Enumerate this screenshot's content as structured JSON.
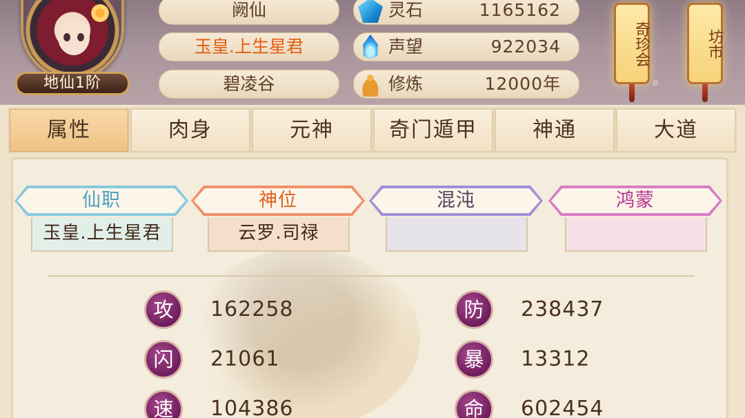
{
  "player": {
    "rank_badge": "地仙1阶",
    "name": "阙仙",
    "title": "玉皇.上生星君",
    "sect": "碧凌谷"
  },
  "resources": [
    {
      "icon": "spirit-stone-icon",
      "label": "灵石",
      "value": "1165162"
    },
    {
      "icon": "reputation-flame-icon",
      "label": "声望",
      "value": "922034"
    },
    {
      "icon": "cultivation-buddha-icon",
      "label": "修炼",
      "value": "12000年"
    }
  ],
  "lanterns": [
    {
      "label": "奇珍会"
    },
    {
      "label": "坊市"
    }
  ],
  "tabs": [
    "属性",
    "肉身",
    "元神",
    "奇门遁甲",
    "神通",
    "大道"
  ],
  "active_tab": "属性",
  "ranks": [
    {
      "header": "仙职",
      "value": "玉皇.上生星君",
      "color": "#4e9fc0",
      "border": "#88c9de",
      "value_bg": "#e2eee8"
    },
    {
      "header": "神位",
      "value": "云罗.司禄",
      "color": "#e0621c",
      "border": "#f0906a",
      "value_bg": "#f6dfca"
    },
    {
      "header": "混沌",
      "value": "",
      "color": "#5a3e5e",
      "border": "#9f8fd8",
      "value_bg": "#e7e3ea"
    },
    {
      "header": "鸿蒙",
      "value": "",
      "color": "#b8338f",
      "border": "#d97cc4",
      "value_bg": "#f6dfe6"
    }
  ],
  "stats": [
    {
      "badge": "攻",
      "value": "162258"
    },
    {
      "badge": "防",
      "value": "238437"
    },
    {
      "badge": "闪",
      "value": "21061"
    },
    {
      "badge": "暴",
      "value": "13312"
    },
    {
      "badge": "速",
      "value": "104386"
    },
    {
      "badge": "命",
      "value": "602454"
    }
  ]
}
